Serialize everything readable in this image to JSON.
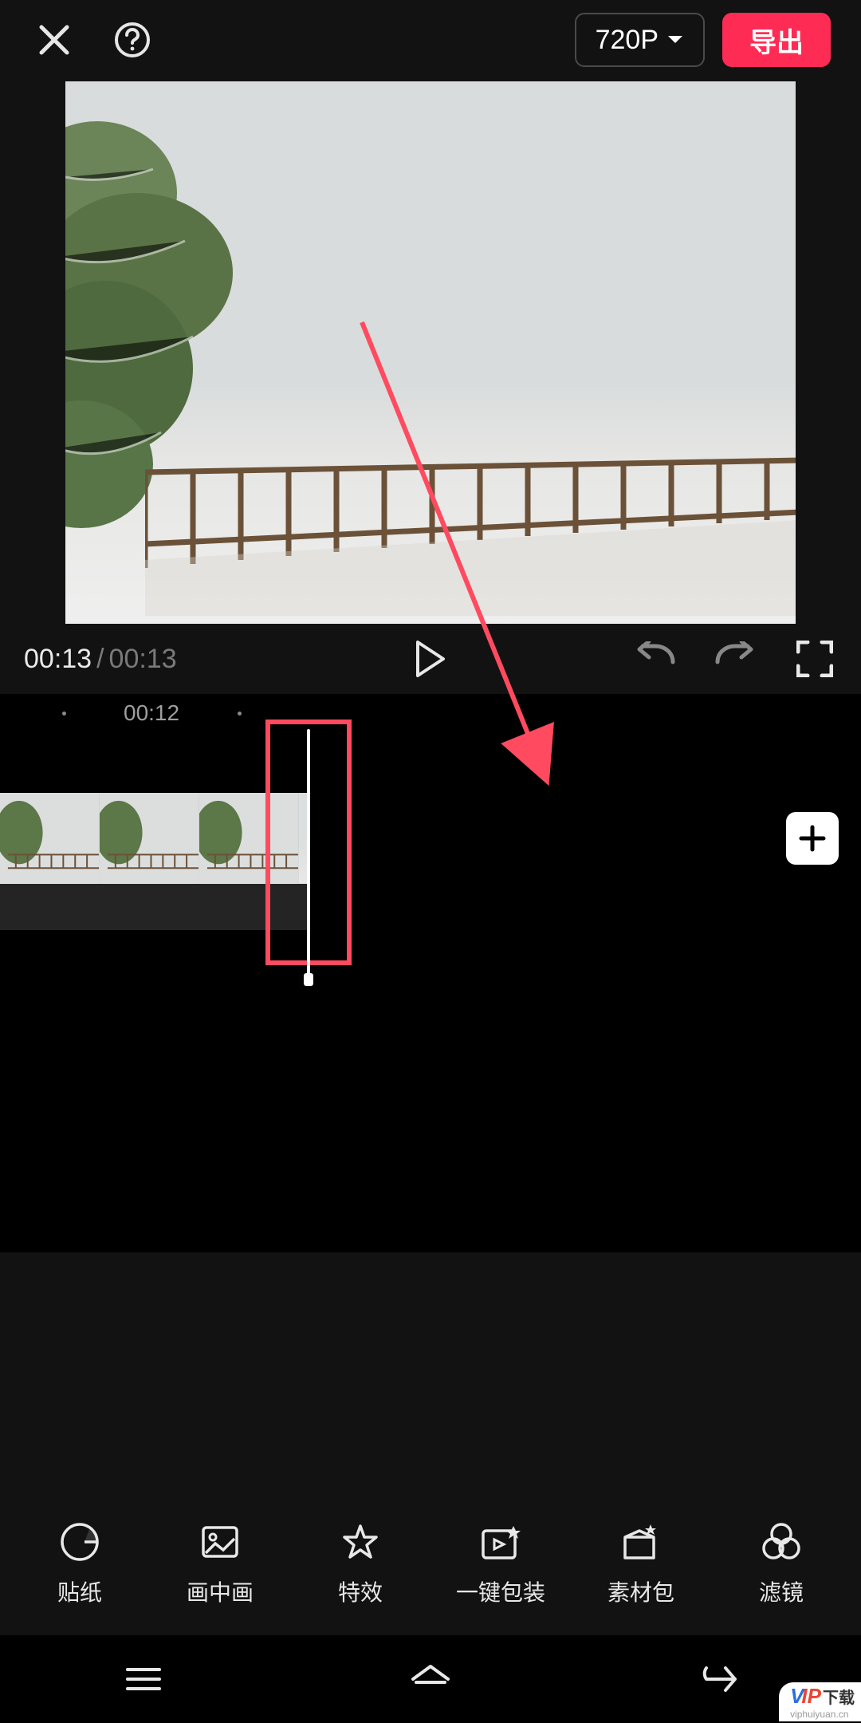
{
  "header": {
    "resolution_label": "720P",
    "export_label": "导出"
  },
  "playback": {
    "current_time": "00:13",
    "separator": "/",
    "total_time": "00:13"
  },
  "ruler": {
    "label": "00:12"
  },
  "add_label": "+",
  "toolbar": [
    {
      "key": "sticker",
      "label": "贴纸"
    },
    {
      "key": "pip",
      "label": "画中画"
    },
    {
      "key": "effects",
      "label": "特效"
    },
    {
      "key": "autopack",
      "label": "一键包装"
    },
    {
      "key": "assets",
      "label": "素材包"
    },
    {
      "key": "filter",
      "label": "滤镜"
    }
  ],
  "watermark": {
    "brand_part1": "V",
    "brand_part2": "IP",
    "brand_suffix": "下载",
    "sub": "viphuiyuan.cn"
  },
  "colors": {
    "accent": "#fe2c55",
    "annotation": "#ff4a5f"
  }
}
